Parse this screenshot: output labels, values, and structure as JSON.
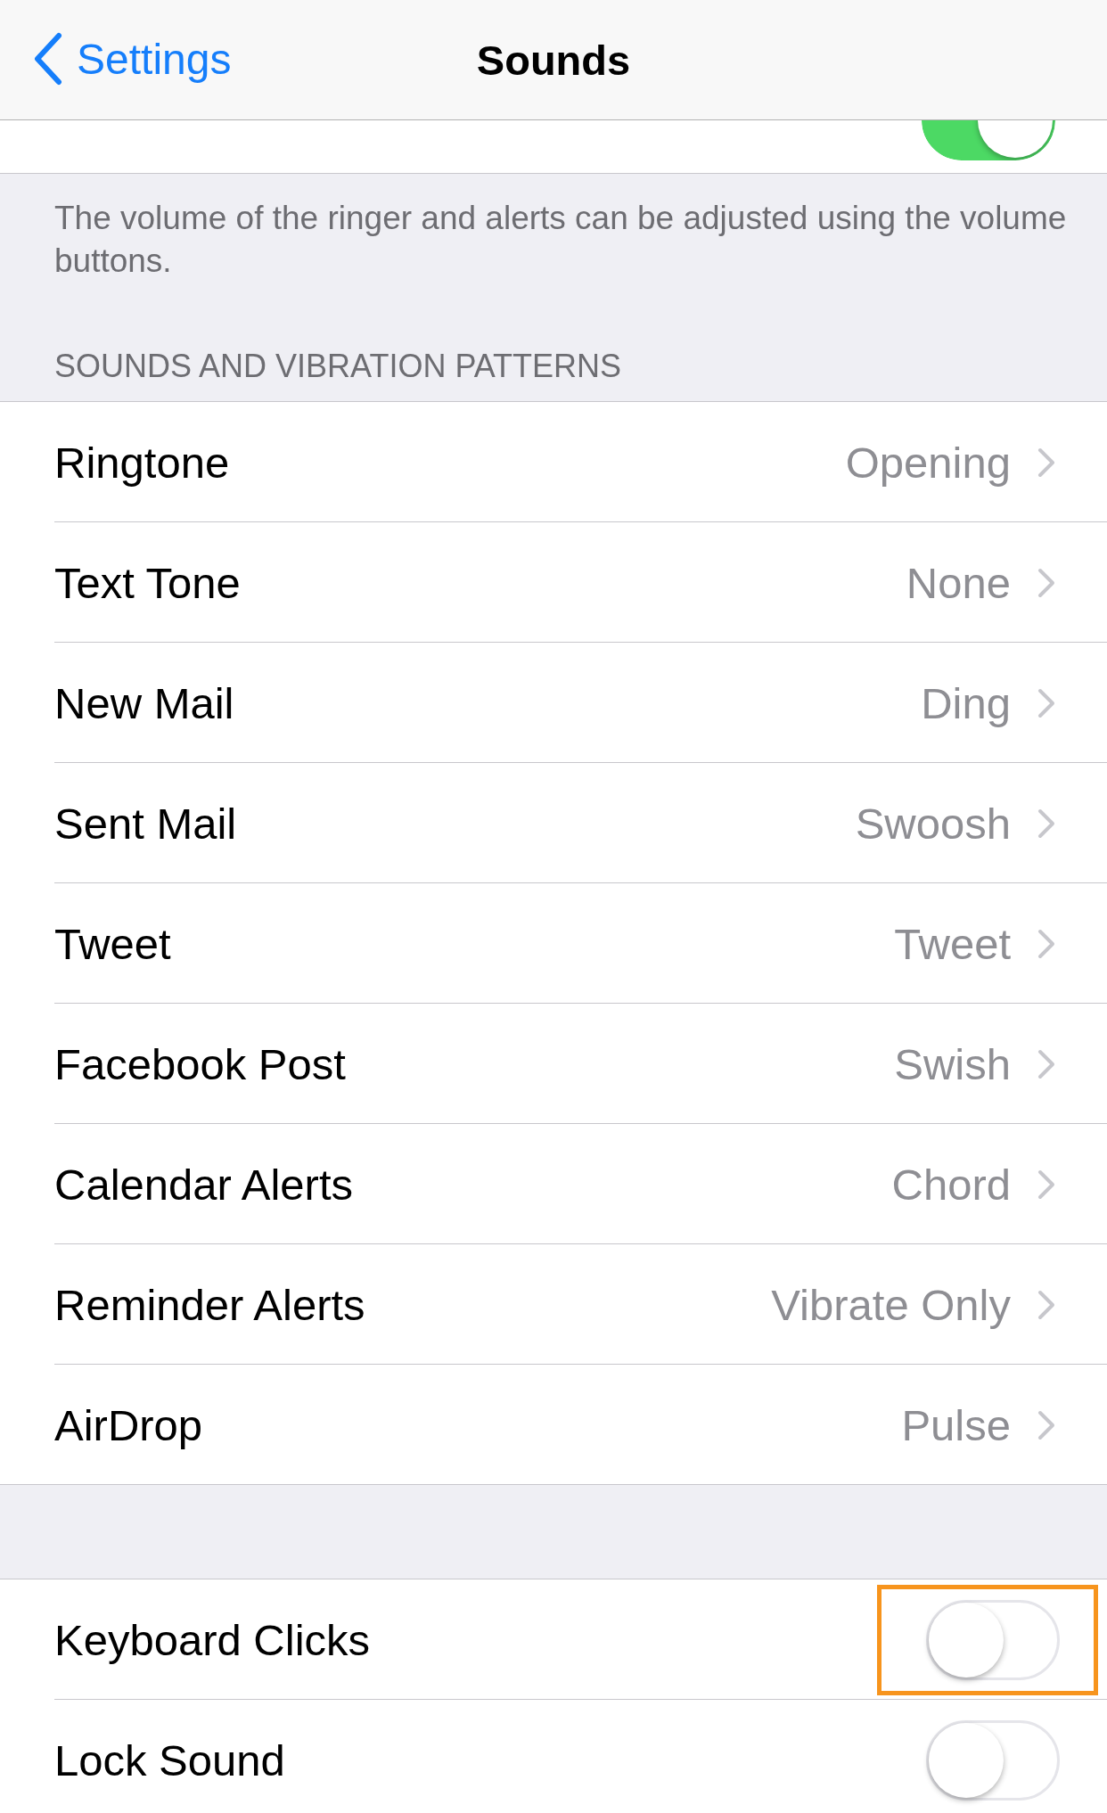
{
  "nav_bar": {
    "back_label": "Settings",
    "title": "Sounds"
  },
  "top_row": {
    "on": true
  },
  "footer": "The volume of the ringer and alerts can be adjusted using the volume buttons.",
  "section_header": "SOUNDS AND VIBRATION PATTERNS",
  "sound_rows": [
    {
      "label": "Ringtone",
      "value": "Opening"
    },
    {
      "label": "Text Tone",
      "value": "None"
    },
    {
      "label": "New Mail",
      "value": "Ding"
    },
    {
      "label": "Sent Mail",
      "value": "Swoosh"
    },
    {
      "label": "Tweet",
      "value": "Tweet"
    },
    {
      "label": "Facebook Post",
      "value": "Swish"
    },
    {
      "label": "Calendar Alerts",
      "value": "Chord"
    },
    {
      "label": "Reminder Alerts",
      "value": "Vibrate Only"
    },
    {
      "label": "AirDrop",
      "value": "Pulse"
    }
  ],
  "toggle_rows": [
    {
      "label": "Keyboard Clicks",
      "on": false,
      "highlighted": true
    },
    {
      "label": "Lock Sound",
      "on": false,
      "highlighted": false
    }
  ]
}
